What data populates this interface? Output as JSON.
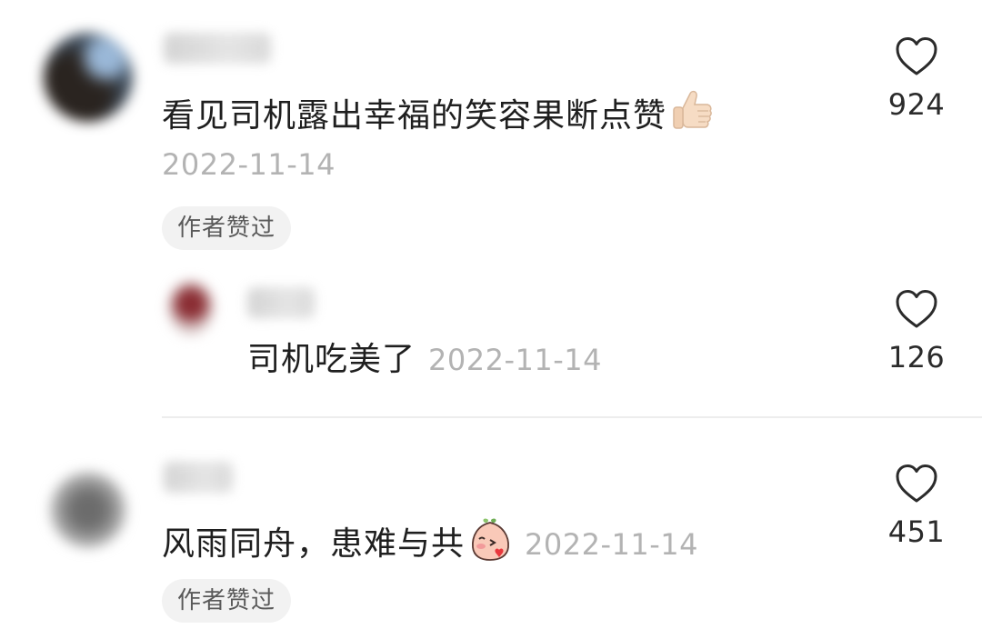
{
  "comments": [
    {
      "text": "看见司机露出幸福的笑容果断点赞",
      "emoji": "thumbs-up",
      "date": "2022-11-14",
      "badge": "作者赞过",
      "likes": "924"
    },
    {
      "text": "司机吃美了",
      "date": "2022-11-14",
      "likes": "126"
    },
    {
      "text": "风雨同舟，患难与共",
      "emoji": "blushing-peach-sticker",
      "date": "2022-11-14",
      "badge": "作者赞过",
      "likes": "451"
    }
  ],
  "colors": {
    "text": "#1f1f1f",
    "muted": "#b3b3b3",
    "pill_bg": "#f2f2f2",
    "pill_text": "#5a5a5a",
    "heart_stroke": "#2b2b2b"
  }
}
